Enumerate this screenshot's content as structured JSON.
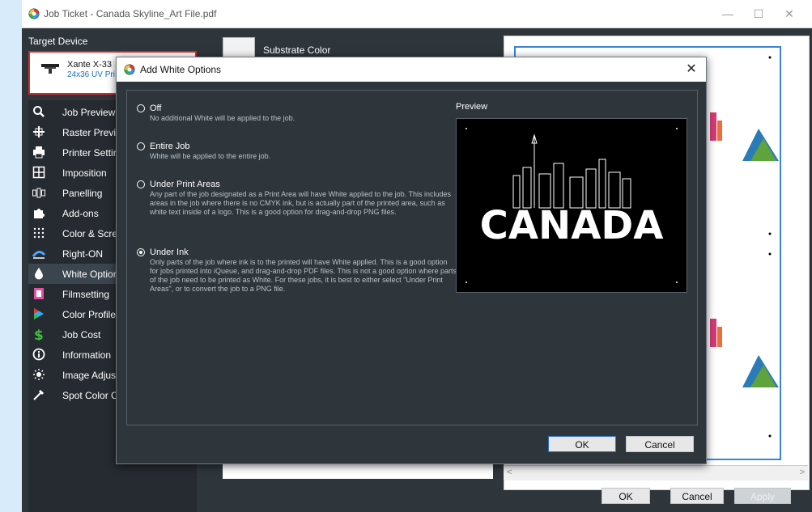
{
  "window": {
    "title": "Job Ticket - Canada Skyline_Art File.pdf",
    "controls": {
      "minimize": "—",
      "maximize": "☐",
      "close": "✕"
    }
  },
  "target": {
    "label": "Target Device",
    "device_name": "Xante X-33",
    "device_sub": "24x36 UV Pri"
  },
  "sidebar": {
    "items": [
      {
        "label": "Job Preview",
        "icon": "magnifier-icon"
      },
      {
        "label": "Raster Previe",
        "icon": "raster-icon"
      },
      {
        "label": "Printer Settir",
        "icon": "printer-icon"
      },
      {
        "label": "Imposition",
        "icon": "grid-icon"
      },
      {
        "label": "Panelling",
        "icon": "panels-icon"
      },
      {
        "label": "Add-ons",
        "icon": "puzzle-icon"
      },
      {
        "label": "Color & Scre",
        "icon": "dots-icon"
      },
      {
        "label": "Right-ON",
        "icon": "right-on-icon"
      },
      {
        "label": "White Optior",
        "icon": "droplet-icon"
      },
      {
        "label": "Filmsetting",
        "icon": "film-icon"
      },
      {
        "label": "Color Profile",
        "icon": "color-profile-icon"
      },
      {
        "label": "Job Cost",
        "icon": "dollar-icon"
      },
      {
        "label": "Information",
        "icon": "info-icon"
      },
      {
        "label": "Image Adjus",
        "icon": "sun-icon"
      },
      {
        "label": "Spot Color C",
        "icon": "dropper-icon"
      }
    ],
    "active_index": 8
  },
  "middle": {
    "substrate_label": "Substrate Color"
  },
  "footer": {
    "ok": "OK",
    "cancel": "Cancel",
    "apply": "Apply"
  },
  "dialog": {
    "title": "Add White Options",
    "close": "✕",
    "preview_label": "Preview",
    "preview_text": "CANADA",
    "options": [
      {
        "title": "Off",
        "desc": "No additional White will be applied to the job.",
        "selected": false
      },
      {
        "title": "Entire Job",
        "desc": "White will be applied to the entire job.",
        "selected": false
      },
      {
        "title": "Under Print Areas",
        "desc": "Any part of the job designated as a Print Area will have White applied to the job.  This includes areas in the job where there is no CMYK ink, but is actually part of the printed area, such as white text inside of a logo.  This is a good option for drag-and-drop PNG files.",
        "selected": false
      },
      {
        "title": "Under Ink",
        "desc": "Only parts of the job where ink is to the printed will have White applied. This is a good option for jobs printed into iQueue, and drag-and-drop PDF files.  This is not a good option where parts of the job need to be printed as White.  For these jobs, it is best to either select \"Under Print Areas\", or to convert the job to a PNG file.",
        "selected": true
      }
    ],
    "ok": "OK",
    "cancel": "Cancel"
  },
  "colors": {
    "background": "#2e353b",
    "sidebar": "#252b30",
    "accent_blue": "#3a85d6",
    "device_border": "#d52b2b"
  }
}
